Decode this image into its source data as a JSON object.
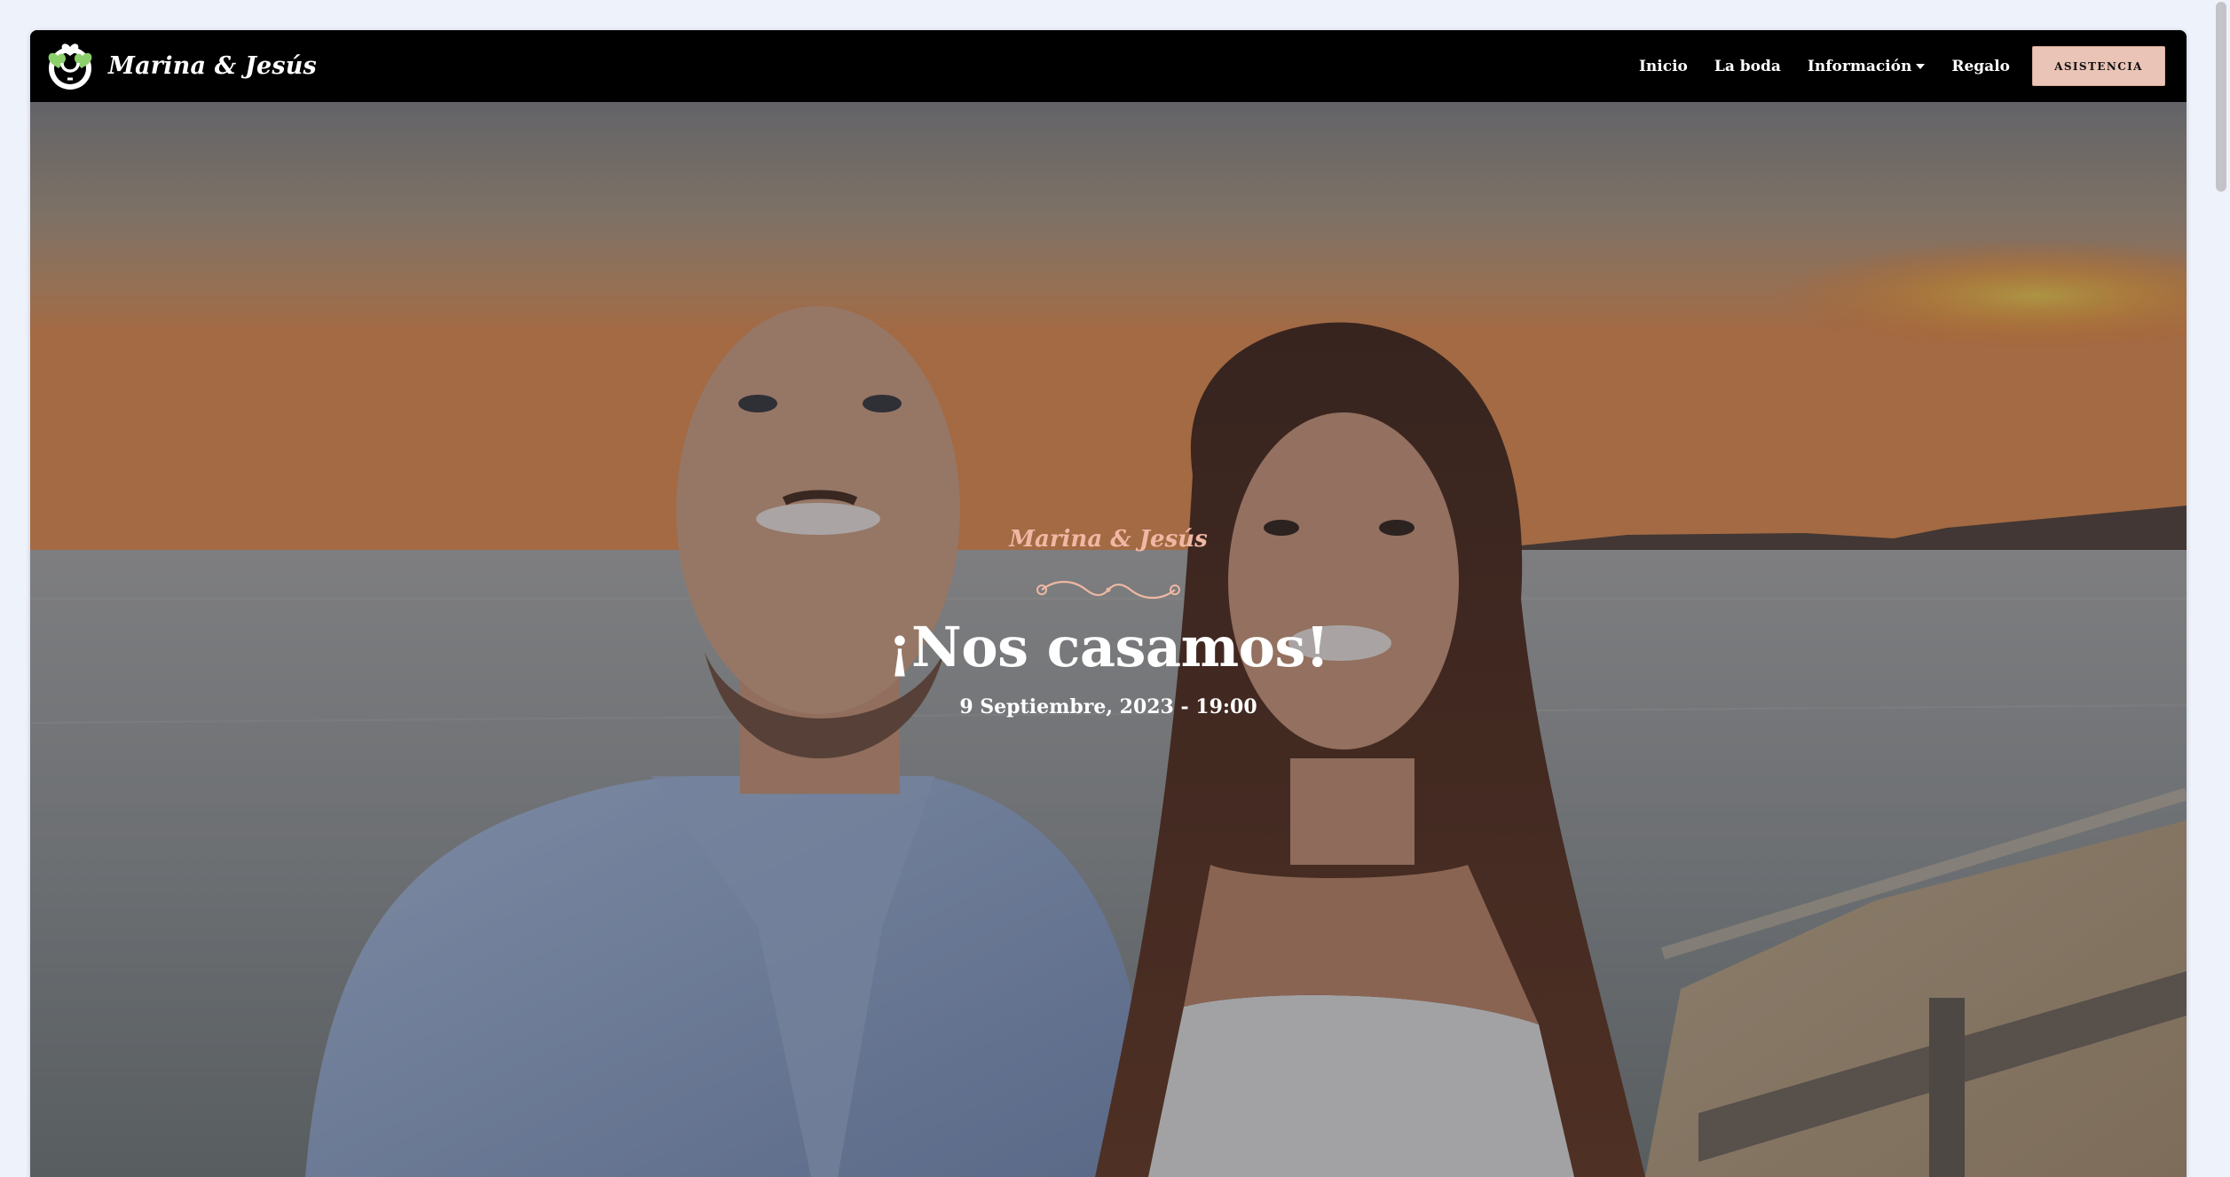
{
  "navbar": {
    "brand_text": "Marina & Jesús",
    "logo_icon": "couple-hearts-logo-icon",
    "links": [
      {
        "label": "Inicio"
      },
      {
        "label": "La boda"
      },
      {
        "label": "Información",
        "has_dropdown": true
      },
      {
        "label": "Regalo"
      }
    ],
    "cta_label": "ASISTENCIA"
  },
  "hero": {
    "couple_name": "Marina & Jesús",
    "headline": "¡Nos casamos!",
    "date": "9 Septiembre, 2023 - 19:00",
    "ornament_icon": "flourish-divider-icon",
    "background_image": "couple-at-sunset-beach-photo"
  },
  "colors": {
    "navbar_bg": "#000000",
    "accent": "#eac4b6",
    "couple_name": "#f0b8a4",
    "page_bg": "#eef2fb"
  }
}
